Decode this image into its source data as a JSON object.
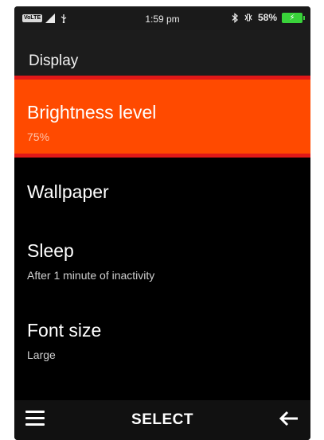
{
  "status_bar": {
    "volte": "VoLTE",
    "time": "1:59 pm",
    "battery": "58%"
  },
  "header": {
    "title": "Display"
  },
  "menu": {
    "items": [
      {
        "label": "Brightness level",
        "sub": "75%",
        "selected": true
      },
      {
        "label": "Wallpaper"
      },
      {
        "label": "Sleep",
        "sub": "After 1 minute of inactivity"
      },
      {
        "label": "Font size",
        "sub": "Large"
      }
    ]
  },
  "softkeys": {
    "left_icon": "menu-icon",
    "center": "SELECT",
    "right_icon": "back-arrow-icon"
  },
  "colors": {
    "selected_bg": "#ff4a00",
    "highlight_border": "#e01818",
    "battery": "#39d23a"
  }
}
